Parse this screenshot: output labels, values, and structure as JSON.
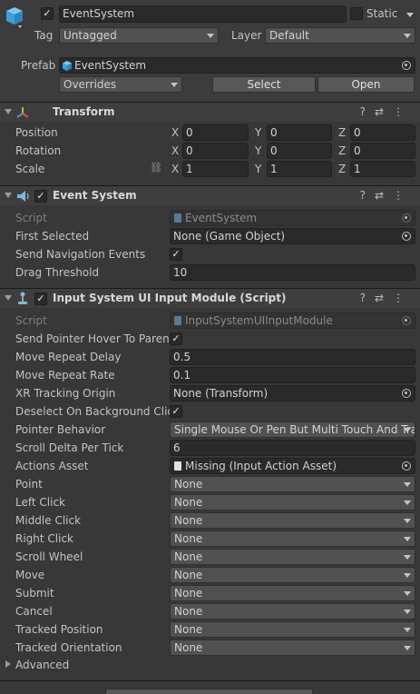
{
  "gameobject": {
    "name": "EventSystem",
    "static_label": "Static",
    "tag_label": "Tag",
    "tag_value": "Untagged",
    "layer_label": "Layer",
    "layer_value": "Default",
    "prefab_label": "Prefab",
    "prefab_value": "EventSystem",
    "overrides_label": "Overrides",
    "select_label": "Select",
    "open_label": "Open"
  },
  "transform": {
    "title": "Transform",
    "rows": [
      {
        "label": "Position",
        "x": "0",
        "y": "0",
        "z": "0"
      },
      {
        "label": "Rotation",
        "x": "0",
        "y": "0",
        "z": "0"
      },
      {
        "label": "Scale",
        "x": "1",
        "y": "1",
        "z": "1"
      }
    ],
    "axis": {
      "x": "X",
      "y": "Y",
      "z": "Z"
    }
  },
  "event_system": {
    "title": "Event System",
    "script_label": "Script",
    "script_value": "EventSystem",
    "first_selected_label": "First Selected",
    "first_selected_value": "None (Game Object)",
    "send_nav_label": "Send Navigation Events",
    "send_nav_checked": "✓",
    "drag_label": "Drag Threshold",
    "drag_value": "10"
  },
  "input_module": {
    "title": "Input System UI Input Module (Script)",
    "script_label": "Script",
    "script_value": "InputSystemUIInputModule",
    "hover_label": "Send Pointer Hover To Parent",
    "hover_checked": "✓",
    "repeat_delay_label": "Move Repeat Delay",
    "repeat_delay_value": "0.5",
    "repeat_rate_label": "Move Repeat Rate",
    "repeat_rate_value": "0.1",
    "xr_label": "XR Tracking Origin",
    "xr_value": "None (Transform)",
    "deselect_label": "Deselect On Background Click",
    "deselect_checked": "✓",
    "pointer_label": "Pointer Behavior",
    "pointer_value": "Single Mouse Or Pen But Multi Touch And Track",
    "scroll_label": "Scroll Delta Per Tick",
    "scroll_value": "6",
    "actions_label": "Actions Asset",
    "actions_value": "Missing (Input Action Asset)",
    "actions": [
      {
        "label": "Point",
        "value": "None"
      },
      {
        "label": "Left Click",
        "value": "None"
      },
      {
        "label": "Middle Click",
        "value": "None"
      },
      {
        "label": "Right Click",
        "value": "None"
      },
      {
        "label": "Scroll Wheel",
        "value": "None"
      },
      {
        "label": "Move",
        "value": "None"
      },
      {
        "label": "Submit",
        "value": "None"
      },
      {
        "label": "Cancel",
        "value": "None"
      },
      {
        "label": "Tracked Position",
        "value": "None"
      },
      {
        "label": "Tracked Orientation",
        "value": "None"
      }
    ],
    "advanced_label": "Advanced"
  },
  "icons": {
    "help": "?",
    "presets": "⇄",
    "menu": "⋮",
    "link": "⛓"
  }
}
